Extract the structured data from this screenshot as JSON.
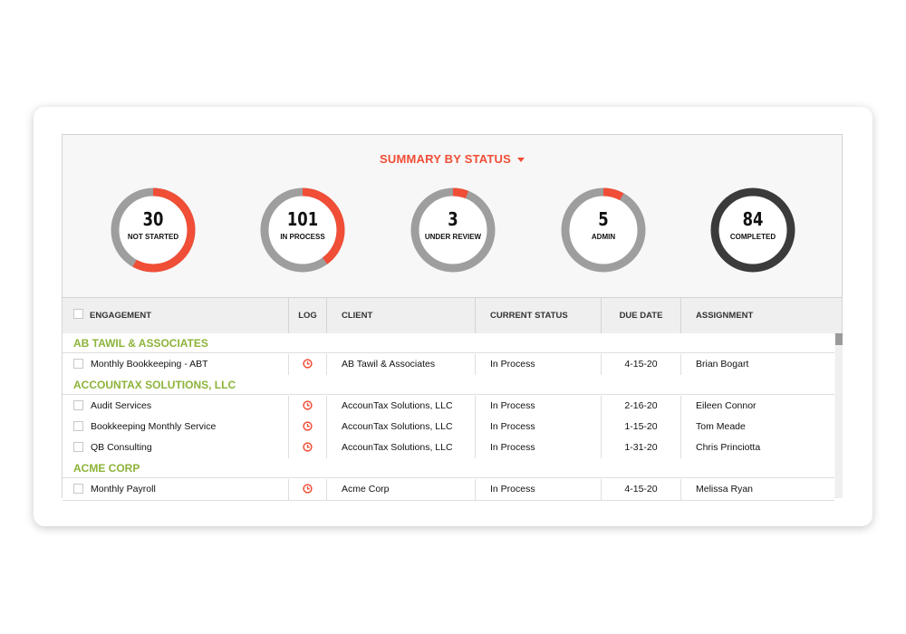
{
  "summary": {
    "title": "SUMMARY BY STATUS",
    "colors": {
      "accent": "#f04e37",
      "track": "#9e9e9e",
      "completed": "#3b3b3b"
    },
    "statuses": [
      {
        "count": "30",
        "label": "NOT STARTED",
        "fraction": 0.58
      },
      {
        "count": "101",
        "label": "IN PROCESS",
        "fraction": 0.4
      },
      {
        "count": "3",
        "label": "UNDER REVIEW",
        "fraction": 0.06
      },
      {
        "count": "5",
        "label": "ADMIN",
        "fraction": 0.08
      },
      {
        "count": "84",
        "label": "COMPLETED",
        "fraction": 0.0
      }
    ]
  },
  "table": {
    "headers": {
      "engagement": "ENGAGEMENT",
      "log": "LOG",
      "client": "CLIENT",
      "status": "CURRENT STATUS",
      "due": "DUE DATE",
      "assignment": "ASSIGNMENT"
    },
    "groups": [
      {
        "name": "AB TAWIL & ASSOCIATES",
        "rows": [
          {
            "engagement": "Monthly Bookkeeping - ABT",
            "client": "AB Tawil & Associates",
            "status": "In Process",
            "due": "4-15-20",
            "assignment": "Brian Bogart"
          }
        ]
      },
      {
        "name": "ACCOUNTAX SOLUTIONS, LLC",
        "rows": [
          {
            "engagement": "Audit Services",
            "client": "AccounTax Solutions, LLC",
            "status": "In Process",
            "due": "2-16-20",
            "assignment": "Eileen Connor"
          },
          {
            "engagement": "Bookkeeping Monthly Service",
            "client": "AccounTax Solutions, LLC",
            "status": "In Process",
            "due": "1-15-20",
            "assignment": "Tom Meade"
          },
          {
            "engagement": "QB Consulting",
            "client": "AccounTax Solutions, LLC",
            "status": "In Process",
            "due": "1-31-20",
            "assignment": "Chris Princiotta"
          }
        ]
      },
      {
        "name": "ACME CORP",
        "rows": [
          {
            "engagement": "Monthly Payroll",
            "client": "Acme Corp",
            "status": "In Process",
            "due": "4-15-20",
            "assignment": "Melissa Ryan"
          }
        ]
      }
    ],
    "log_icon": "clock-icon",
    "group_color": "#8db33a"
  }
}
